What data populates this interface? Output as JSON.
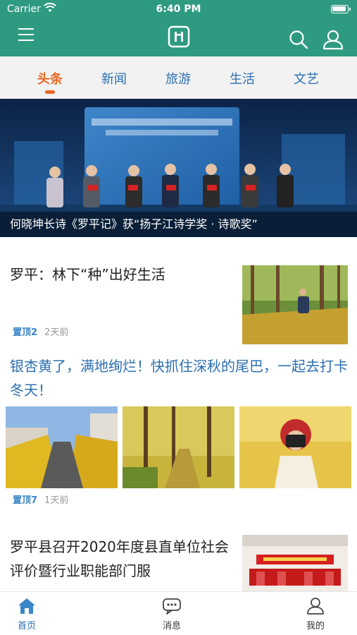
{
  "status_bar": {
    "carrier": "Carrier",
    "time": "6:40 PM",
    "battery_level": 0.95
  },
  "header": {
    "bg_color": "#2f9a82",
    "icons": [
      "menu-icon",
      "app-logo-icon",
      "search-icon",
      "user-icon"
    ]
  },
  "tabs": [
    {
      "label": "头条",
      "active": true
    },
    {
      "label": "新闻",
      "active": false
    },
    {
      "label": "旅游",
      "active": false
    },
    {
      "label": "生活",
      "active": false
    },
    {
      "label": "文艺",
      "active": false
    }
  ],
  "hero": {
    "caption": "何晓坤长诗《罗平记》获“扬子江诗学奖 · 诗歌奖”"
  },
  "articles": [
    {
      "title": "罗平：林下“种”出好生活",
      "pin": "置顶2",
      "time": "2天前"
    },
    {
      "title": "银杏黄了，满地绚烂！快抓住深秋的尾巴，一起去打卡冬天！",
      "pin": "置顶7",
      "time": "1天前"
    },
    {
      "title": "罗平县召开2020年度县直单位社会评价暨行业职能部门服"
    }
  ],
  "bottom_nav": [
    {
      "label": "首页",
      "icon": "home-icon",
      "active": true
    },
    {
      "label": "消息",
      "icon": "message-icon",
      "active": false
    },
    {
      "label": "我的",
      "icon": "profile-icon",
      "active": false
    }
  ],
  "colors": {
    "accent": "#e8681f",
    "link_blue": "#2c6fb0",
    "pin_blue": "#3a86c8"
  }
}
